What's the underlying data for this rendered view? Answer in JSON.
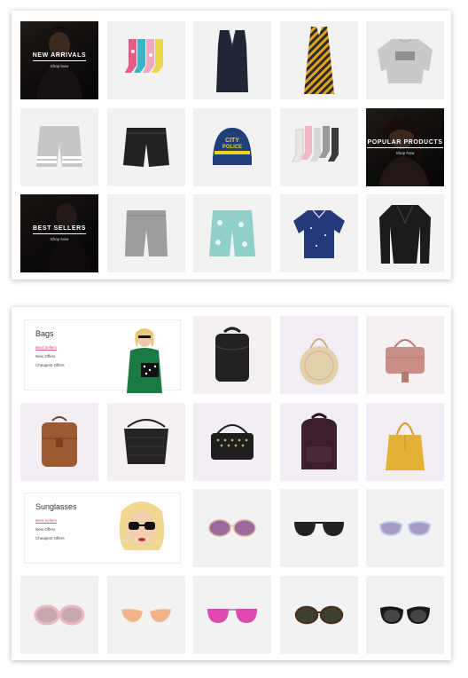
{
  "top_grid": {
    "new_arrivals": {
      "title": "NEW ARRIVALS",
      "link": "Shop Now"
    },
    "popular_products": {
      "title": "POPULAR PRODUCTS",
      "link": "Shop Now"
    },
    "best_sellers": {
      "title": "BEST SELLERS",
      "link": "Shop Now"
    }
  },
  "bags": {
    "title": "Bags",
    "links": [
      "Best Sellers",
      "New Offers",
      "Cheapest Offers"
    ]
  },
  "sunglasses": {
    "title": "Sunglasses",
    "links": [
      "Best Sellers",
      "New Offers",
      "Cheapest Offers"
    ]
  },
  "colors": {
    "accent": "#e24a7b",
    "promo_bg": "#151515",
    "tile_bg": "#f2f2f2"
  }
}
